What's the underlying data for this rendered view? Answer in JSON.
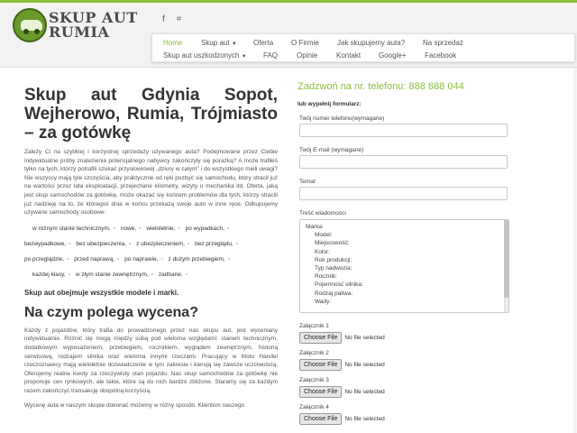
{
  "header": {
    "brand_line1": "SKUP AUT",
    "brand_line2": "RUMIA",
    "social_icons": [
      "facebook-icon",
      "vk-icon"
    ]
  },
  "nav": {
    "row1": [
      "Home",
      "Skup aut",
      "Oferta",
      "O Firmie",
      "Jak skupujemy auta?",
      "Na sprzedaż"
    ],
    "row2": [
      "Skup aut uszkodzonych",
      "FAQ",
      "Opinie",
      "Kontakt",
      "Google+",
      "Facebook"
    ]
  },
  "article": {
    "title": "Skup aut Gdynia Sopot, Wejherowo, Rumia, Trójmiasto – za gotówkę",
    "intro": "Zależy Ci na szybkiej i korzystnej sprzedaży używanego auta? Podejmowane przez Ciebie indywidualne próby znalezienia potencjalnego nabywcy zakończyły się porażką? A może trafiłeś tylko na tych, którzy potrafili szukać przysłowiowej „dziury w całym\" i do wszystkiego mieli uwagi? Nie wszyscy mają tyle szczęścia, aby praktycznie od ręki pozbyć się samochodu, który stracił już na wartości przez lata eksploatacji, przejechane kilometry, wizyty u mechanika itd. Oferta, jaką jest skup samochodów za gotówkę, może okazać się końcem problemów dla tych, którzy stracili już nadzieję na to, że któregoś dnia w końcu przekażą swoje auto w inne ręce. Odkupujemy używane samochody osobowe:",
    "tags": [
      [
        "w różnym stanie technicznym,",
        "nowe,",
        "wieloletnie,",
        "po wypadkach,"
      ],
      [
        "bezwypadkowe,",
        "bez ubezpieczenia,",
        "z ubezpieczeniem,",
        "bez przeglądu,"
      ],
      [
        "po przeglądzie,",
        "przed naprawą,",
        "po naprawie,",
        "z dużym przebiegiem,"
      ],
      [
        "każdej klasy,",
        "w złym stanie zewnętrznym,",
        "zadbane."
      ]
    ],
    "models_line": "Skup aut obejmuje wszystkie modele i marki.",
    "h2": "Na czym polega wycena?",
    "para2": "Każdy z pojazdów, który trafia do prowadzonego przez nas skupu aut, jest wyceniany indywidualnie. Różnić się mogą między sobą pod wieloma względami: stanem technicznym, dodatkowym wyposażeniem, przebiegiem, rocznikiem, wyglądem zewnętrznym, historią serwisową, rodzajem silnika oraz wieloma innymi rzeczami. Pracujący w Moto Handel rzeczoznawcy mają wieloletnie doświadczenie w tym zakresie i kierują się zawsze uczciwością. Oferujemy realne kwoty za rzeczywisty stan pojazdu. Nas skup samochodów za gotówkę nie proponuje cen rynkowych, ale takie, które są do nich bardzo zbliżone. Staramy się za każdym razem zakończyć transakcję obopólną korzyścią.",
    "para3": "Wycenę auta w naszym skupie dokonać możemy w różny sposób. Klientom naszego"
  },
  "form": {
    "phone": "Zadzwoń na nr. telefonu: 888 888 044",
    "title": "lub wypełnij formularz:",
    "phone_label": "Twój numer telefonu(wymagane)",
    "email_label": "Twój E-mail (wymagane)",
    "subject_label": "Temat",
    "message_label": "Treść wiadomości",
    "message_lines": [
      "Marka:",
      "Model:",
      "Miejscowość:",
      "Kolor:",
      "Rok produkcji:",
      "Typ nadwozia:",
      "Rocznik:",
      "Pojemność silnika:",
      "Rodzaj paliwa:",
      "Wady:"
    ],
    "attachments": [
      {
        "label": "Załącznik 1",
        "button": "Choose File",
        "status": "No file selected"
      },
      {
        "label": "Załącznik 2",
        "button": "Choose File",
        "status": "No file selected"
      },
      {
        "label": "Załącznik 3",
        "button": "Choose File",
        "status": "No file selected"
      },
      {
        "label": "Załącznik 4",
        "button": "Choose File",
        "status": "No file selected"
      }
    ]
  },
  "colors": {
    "accent": "#8bbf3c",
    "text": "#444444",
    "header_bg": "#f2f2f2"
  }
}
